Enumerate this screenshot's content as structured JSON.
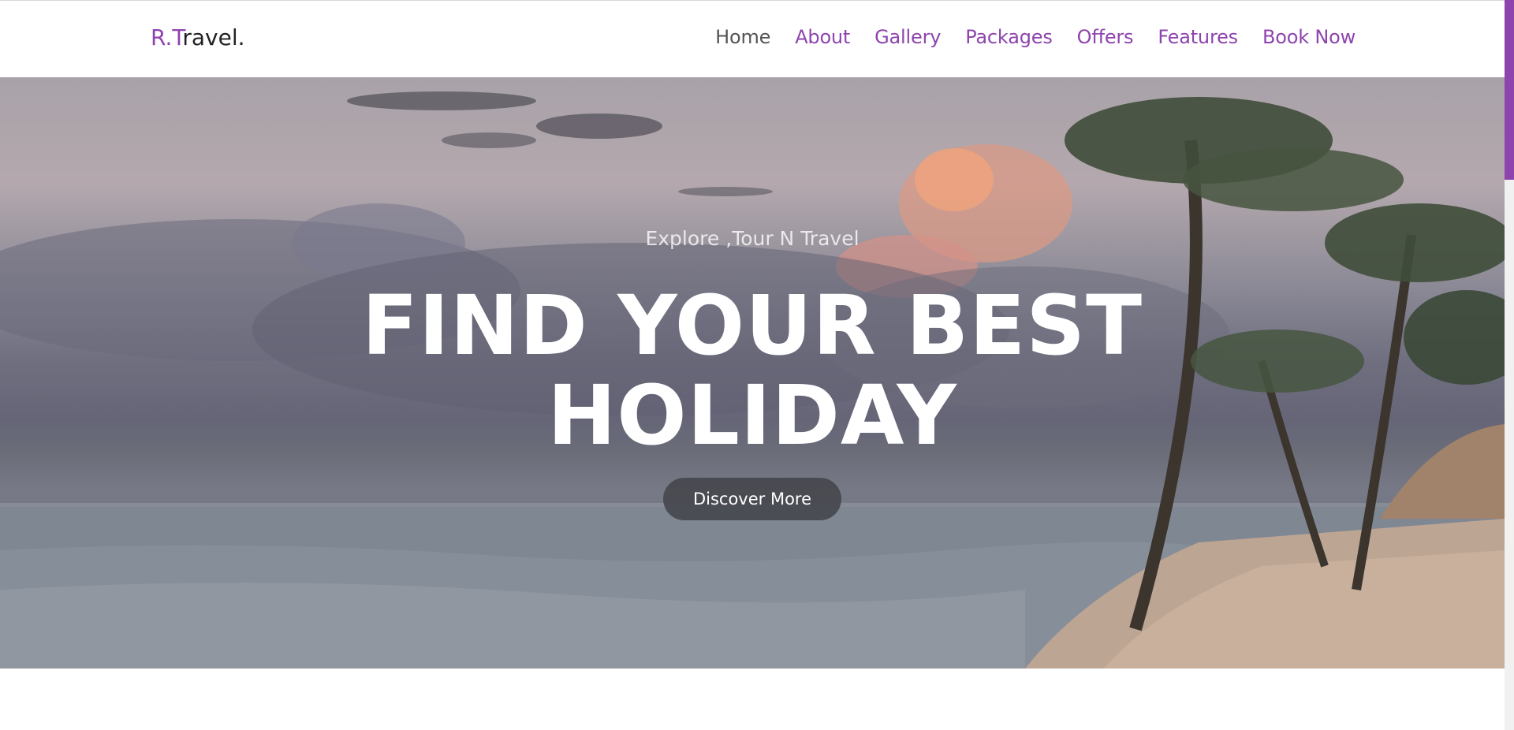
{
  "brand": {
    "logo_prefix": "R.T",
    "logo_suffix": "ravel."
  },
  "nav": {
    "items": [
      {
        "label": "Home",
        "active": true
      },
      {
        "label": "About",
        "active": false
      },
      {
        "label": "Gallery",
        "active": false
      },
      {
        "label": "Packages",
        "active": false
      },
      {
        "label": "Offers",
        "active": false
      },
      {
        "label": "Features",
        "active": false
      },
      {
        "label": "Book Now",
        "active": false
      }
    ]
  },
  "hero": {
    "subtitle": "Explore ,Tour N Travel",
    "title_line1": "FIND YOUR BEST",
    "title_line2": "HOLIDAY",
    "cta_label": "Discover More",
    "prev_icon": "chevron-left-icon",
    "next_icon": "chevron-right-icon",
    "prev_glyph": "‹",
    "next_glyph": "›"
  },
  "colors": {
    "accent": "#8e44ad",
    "nav_active": "#555555",
    "cta_background": "#46484e"
  }
}
